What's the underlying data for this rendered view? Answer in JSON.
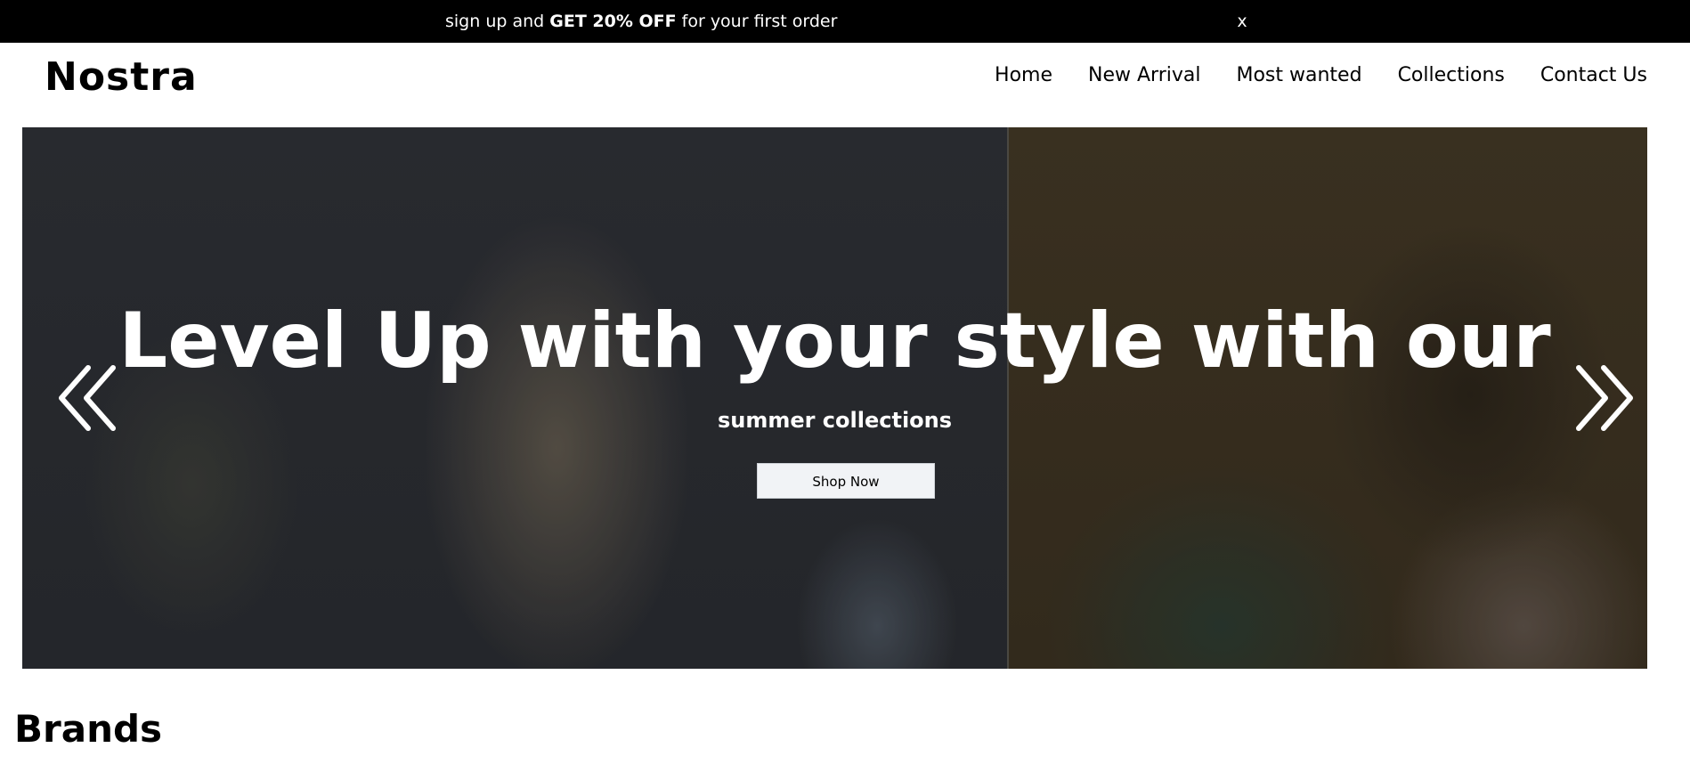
{
  "promo": {
    "text_before": "sign up and ",
    "text_bold": "GET 20% OFF",
    "text_after": " for your first order",
    "close_label": "x"
  },
  "header": {
    "logo": "Nostra",
    "nav": [
      {
        "label": "Home"
      },
      {
        "label": "New Arrival"
      },
      {
        "label": "Most wanted"
      },
      {
        "label": "Collections"
      },
      {
        "label": "Contact Us"
      }
    ]
  },
  "hero": {
    "title": "Level Up with your style with our",
    "subtitle": "summer collections",
    "cta_label": "Shop Now",
    "prev_icon": "double-chevron-left-icon",
    "next_icon": "double-chevron-right-icon",
    "colors": {
      "overlay_text": "#ffffff",
      "button_bg": "#f1f3f6"
    }
  },
  "brands": {
    "heading": "Brands"
  }
}
